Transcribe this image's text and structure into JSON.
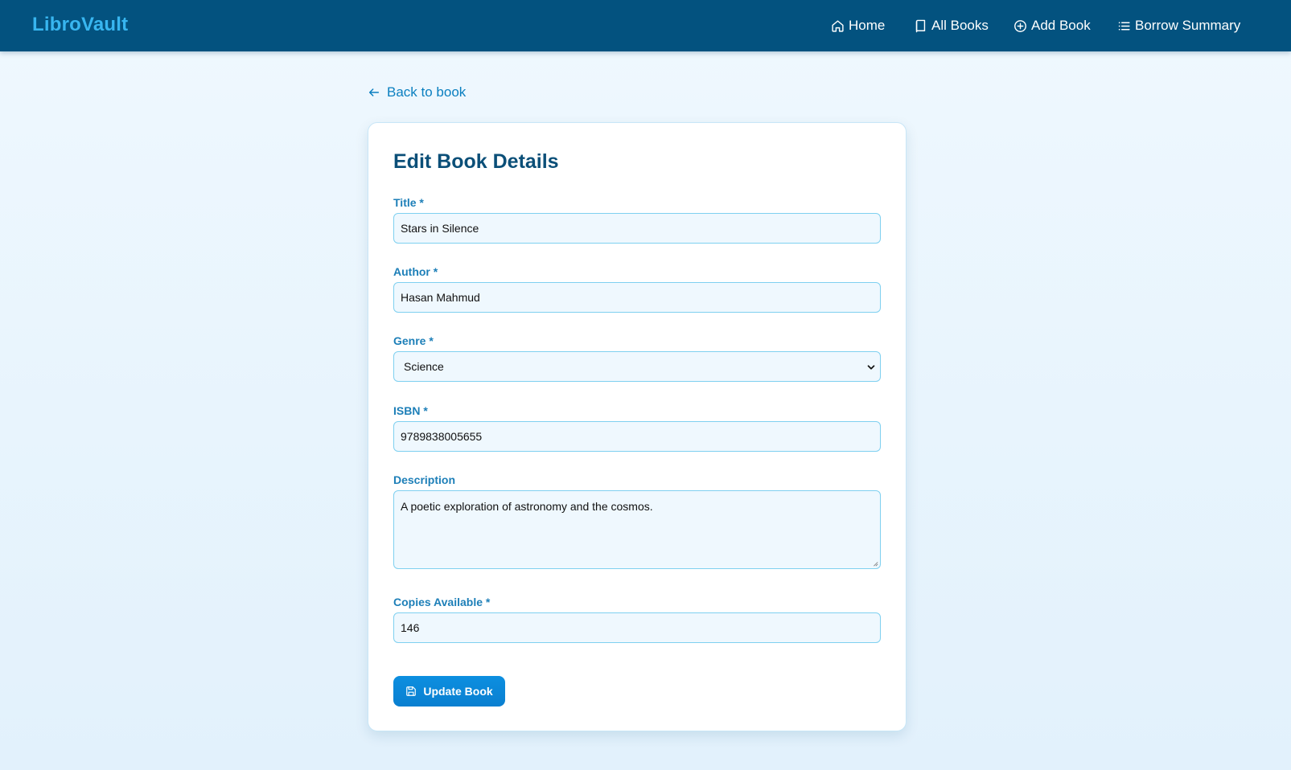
{
  "nav": {
    "brand": "LibroVault",
    "items": [
      {
        "label": "Home",
        "icon": "home-icon"
      },
      {
        "label": "All Books",
        "icon": "book-icon"
      },
      {
        "label": "Add Book",
        "icon": "plus-circle-icon"
      },
      {
        "label": "Borrow Summary",
        "icon": "list-icon"
      }
    ]
  },
  "back_link": {
    "label": "Back to book",
    "icon": "arrow-left-icon"
  },
  "form": {
    "title": "Edit Book Details",
    "fields": {
      "title": {
        "label": "Title *",
        "value": "Stars in Silence"
      },
      "author": {
        "label": "Author *",
        "value": "Hasan Mahmud"
      },
      "genre": {
        "label": "Genre *",
        "value": "Science"
      },
      "isbn": {
        "label": "ISBN *",
        "value": "9789838005655"
      },
      "description": {
        "label": "Description",
        "value": "A poetic exploration of astronomy and the cosmos."
      },
      "copies": {
        "label": "Copies Available *",
        "value": "146"
      }
    },
    "submit_label": "Update Book",
    "submit_icon": "save-icon"
  },
  "colors": {
    "navbar": "#03527f",
    "brand": "#38b6f0",
    "accent": "#0a7fc0",
    "heading": "#0b4f78",
    "label": "#1d7fb8",
    "field_border": "#7fd0f0",
    "field_bg": "#eff8fe",
    "button": "#0a7fd0"
  }
}
